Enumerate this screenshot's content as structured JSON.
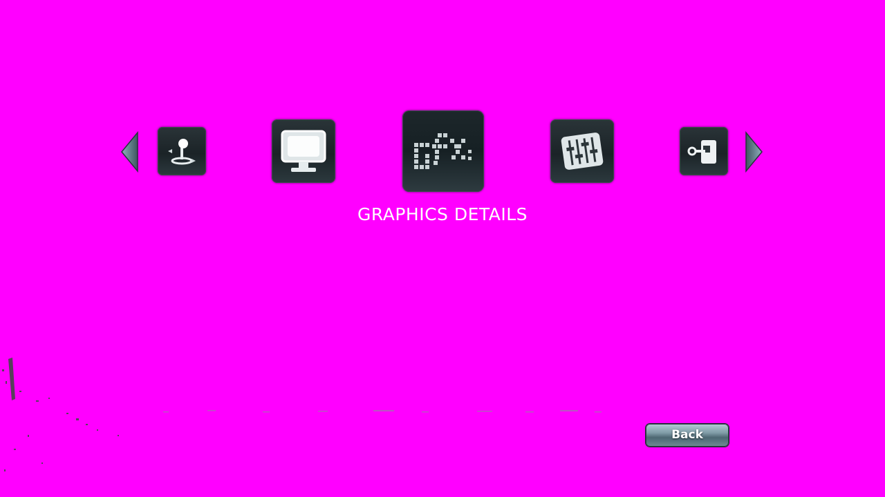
{
  "screen": {
    "background_color": "#ff00ff",
    "section_title": "GRAPHICS DETAILS"
  },
  "carousel": {
    "items": [
      {
        "icon": "joystick-icon",
        "selected": false
      },
      {
        "icon": "monitor-icon",
        "selected": false
      },
      {
        "icon": "gfx-icon",
        "selected": true
      },
      {
        "icon": "mixer-sliders-icon",
        "selected": false
      },
      {
        "icon": "key-lock-icon",
        "selected": false
      }
    ],
    "prev_icon": "arrow-left-icon",
    "next_icon": "arrow-right-icon"
  },
  "footer": {
    "back_label": "Back"
  }
}
